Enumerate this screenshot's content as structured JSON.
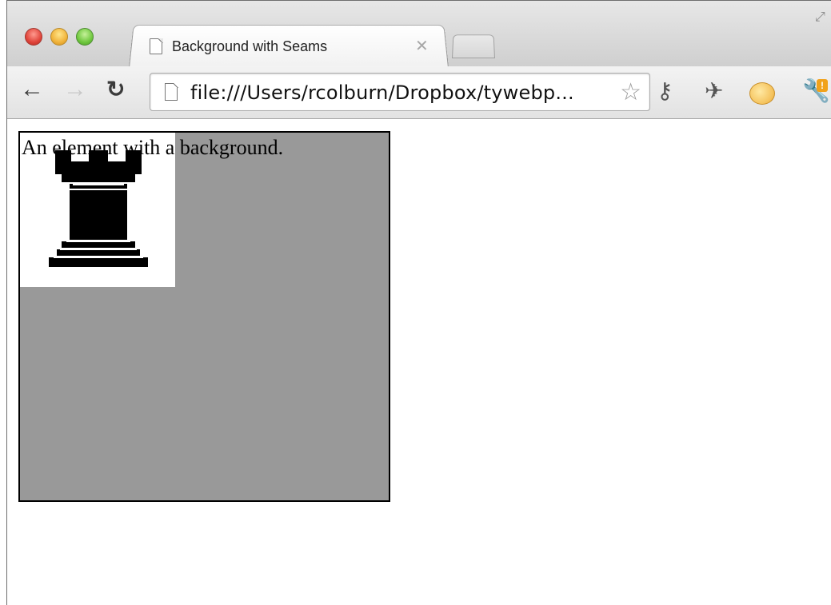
{
  "window": {
    "tab": {
      "title": "Background with Seams"
    },
    "toolbar": {
      "url": "file:///Users/rcolburn/Dropbox/tywebp..."
    },
    "icons": {
      "close": "close-icon",
      "back": "back-arrow-icon",
      "forward": "forward-arrow-icon",
      "reload": "reload-icon",
      "page": "page-icon",
      "star": "star-icon",
      "key": "key-icon",
      "pin": "pin-icon",
      "extension": "puffer-fish-icon",
      "wrench": "wrench-icon",
      "badge": "!"
    }
  },
  "page": {
    "element_text": "An element with a background.",
    "colors": {
      "box_background": "#999999",
      "tile_background": "#ffffff"
    }
  }
}
